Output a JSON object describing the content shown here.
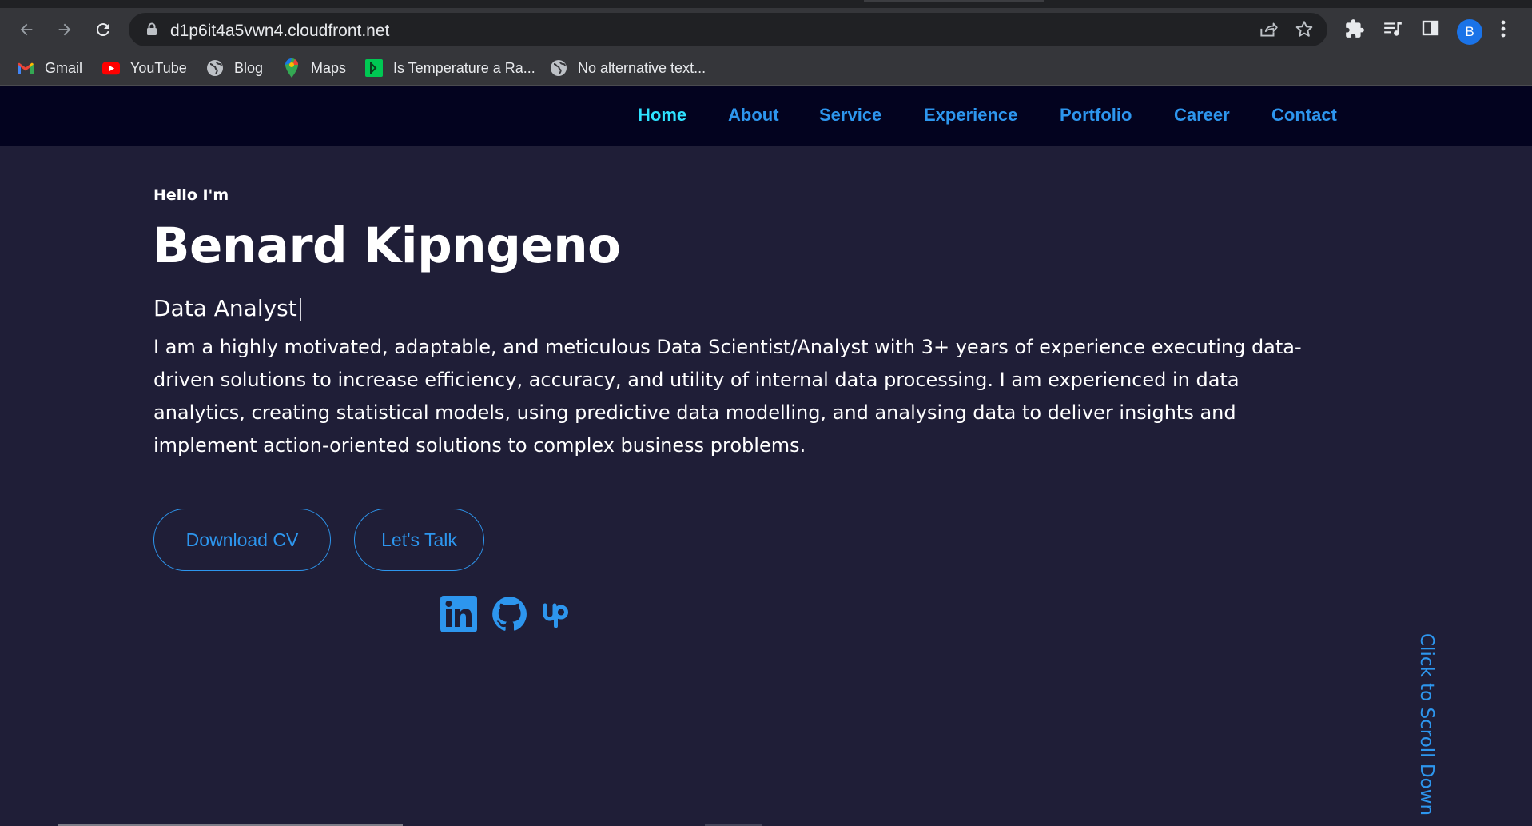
{
  "browser": {
    "url": "d1p6it4a5vwn4.cloudfront.net",
    "profile_initial": "B",
    "toolbar_icons": [
      "back-arrow-icon",
      "forward-arrow-icon",
      "reload-icon",
      "lock-icon",
      "share-icon",
      "star-icon",
      "extensions-icon",
      "media-queue-icon",
      "side-panel-icon",
      "kebab-menu-icon"
    ]
  },
  "bookmarks": [
    {
      "label": "Gmail",
      "icon": "gmail-icon"
    },
    {
      "label": "YouTube",
      "icon": "youtube-icon"
    },
    {
      "label": "Blog",
      "icon": "globe-icon"
    },
    {
      "label": "Maps",
      "icon": "maps-pin-icon"
    },
    {
      "label": "Is Temperature a Ra...",
      "icon": "bookmark-site-icon"
    },
    {
      "label": "No alternative text...",
      "icon": "globe-icon"
    }
  ],
  "nav": {
    "items": [
      {
        "label": "Home"
      },
      {
        "label": "About"
      },
      {
        "label": "Service"
      },
      {
        "label": "Experience"
      },
      {
        "label": "Portfolio"
      },
      {
        "label": "Career"
      },
      {
        "label": "Contact"
      }
    ],
    "active": "Home",
    "accent_color": "#2d96ee",
    "active_color": "#2ee2ff"
  },
  "hero": {
    "greeting": "Hello I'm",
    "name": "Benard Kipngeno",
    "role": "Data Analyst",
    "bio": "I am a highly motivated, adaptable, and meticulous Data Scientist/Analyst with 3+ years of experience executing data-driven solutions to increase efficiency, accuracy, and utility of internal data processing. I am experienced in data analytics, creating statistical models, using predictive data modelling, and analysing data to deliver insights and implement action-oriented solutions to complex business problems.",
    "buttons": {
      "download_cv": "Download CV",
      "lets_talk": "Let's Talk"
    },
    "socials": [
      "linkedin-icon",
      "github-icon",
      "upwork-icon"
    ],
    "scroll_hint": "Click to Scroll Down"
  },
  "colors": {
    "background": "#1f1e37",
    "navbar": "#03031f",
    "text": "#ffffff"
  }
}
